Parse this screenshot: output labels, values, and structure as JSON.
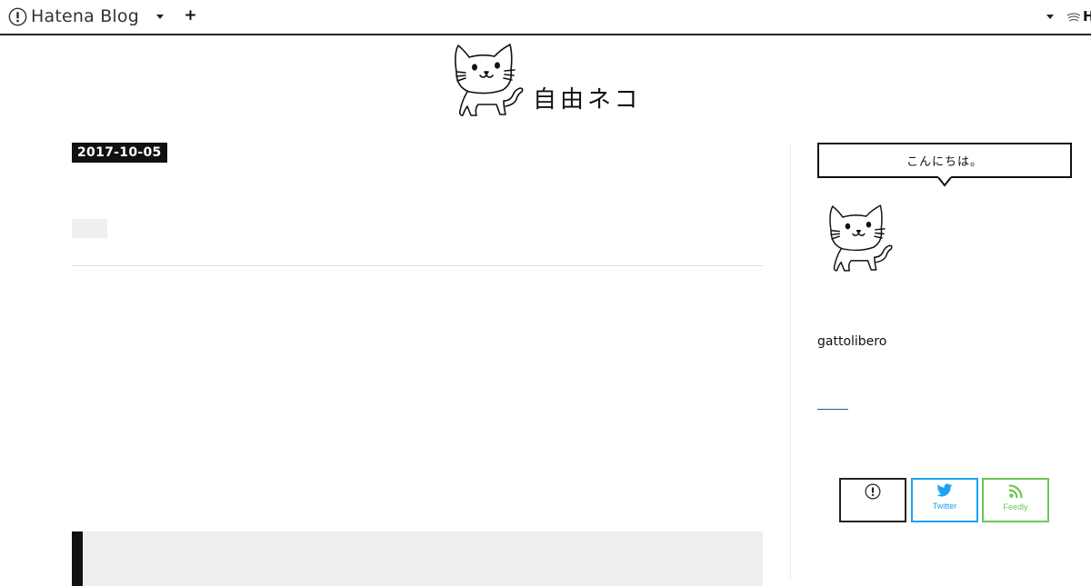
{
  "topbar": {
    "brand_name": "Hatena Blog",
    "right_label": "H",
    "icons": [
      "hatena-logo-icon",
      "caret-down-icon",
      "plus-icon",
      "caret-down-icon",
      "hatena-users-icon"
    ]
  },
  "header": {
    "blog_title": "自由ネコ",
    "logo_icon": "cat-illustration-icon"
  },
  "entry": {
    "date": "2017-10-05"
  },
  "sidebar": {
    "greeting": "こんにちは。",
    "avatar_icon": "cat-illustration-icon",
    "profile_name": "gattolibero",
    "follow_buttons": [
      {
        "label": "",
        "icon": "hatena-logo-icon",
        "color": "#222222"
      },
      {
        "label": "Twitter",
        "icon": "twitter-bird-icon",
        "color": "#1da1f2"
      },
      {
        "label": "Feedly",
        "icon": "rss-feed-icon",
        "color": "#6cc655"
      }
    ]
  },
  "colors": {
    "date_badge_bg": "#111111",
    "twitter": "#1da1f2",
    "feedly": "#6cc655",
    "link": "#1e5aa8"
  }
}
